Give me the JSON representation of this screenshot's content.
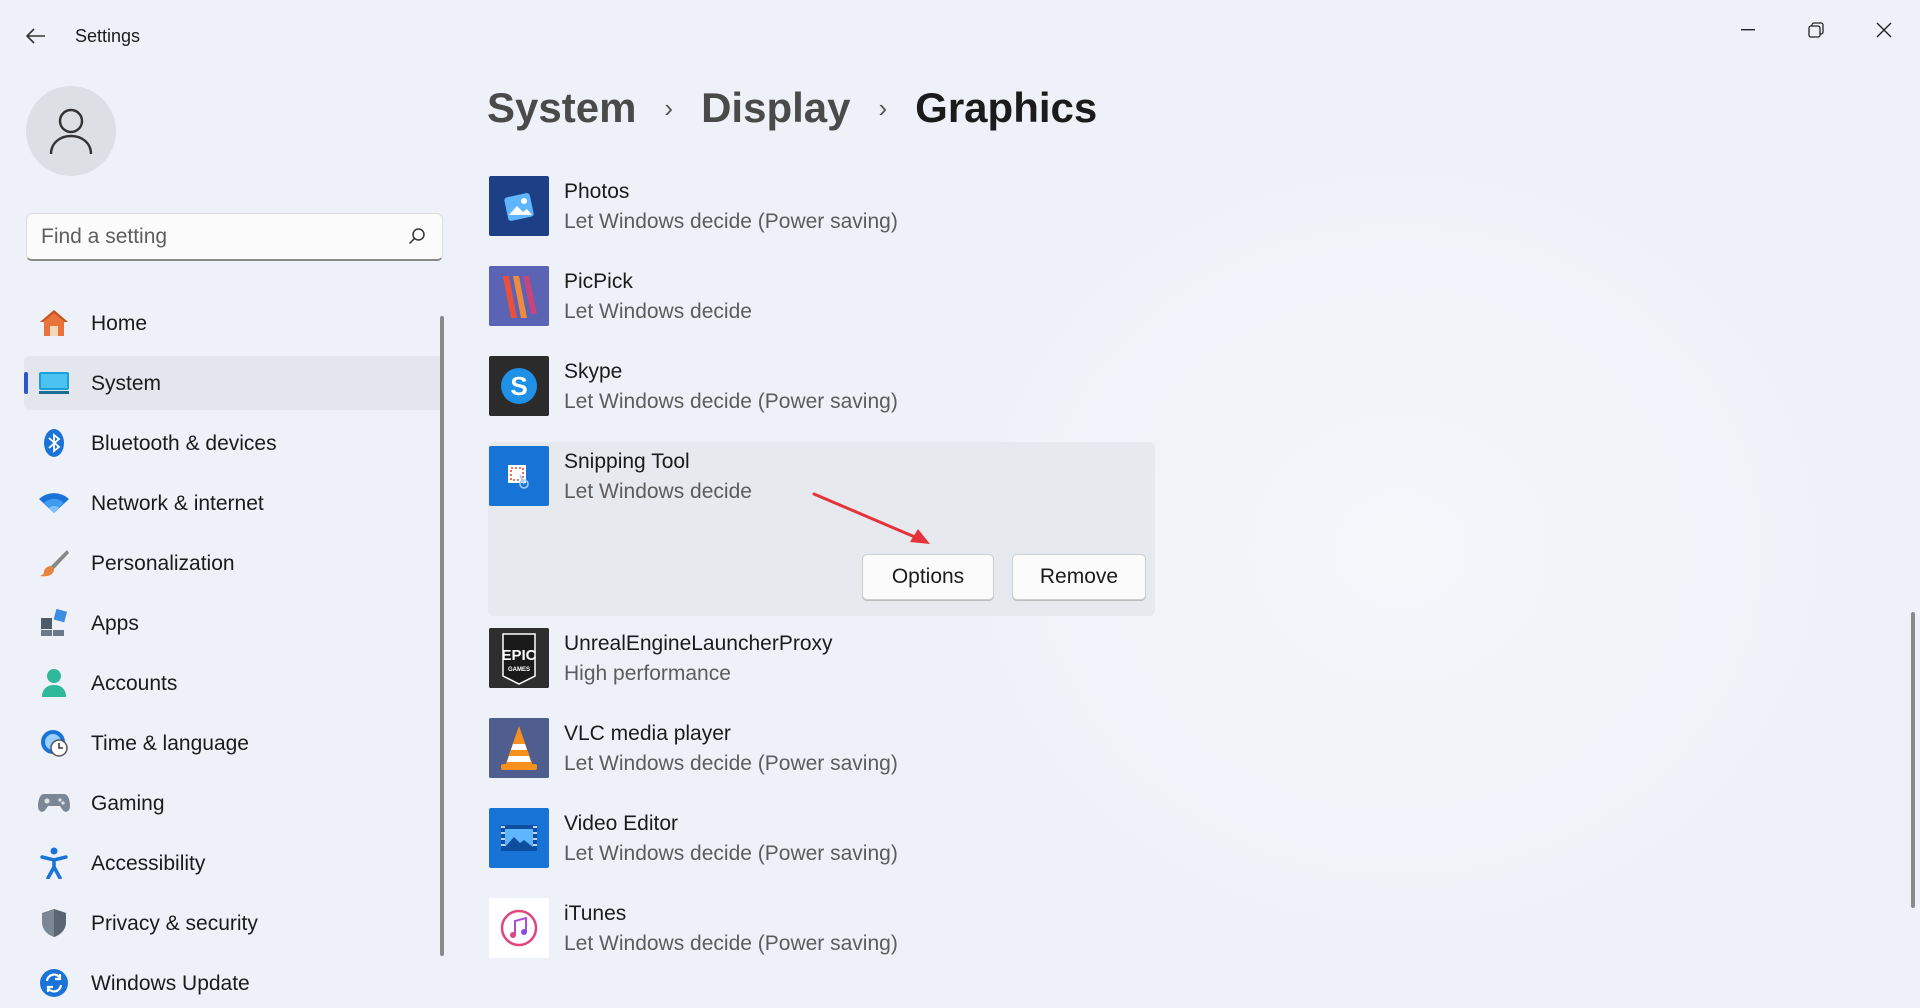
{
  "window": {
    "title": "Settings"
  },
  "sidebar": {
    "search_placeholder": "Find a setting",
    "items": [
      {
        "label": "Home",
        "icon": "home-icon"
      },
      {
        "label": "System",
        "icon": "system-icon",
        "active": true
      },
      {
        "label": "Bluetooth & devices",
        "icon": "bluetooth-icon"
      },
      {
        "label": "Network & internet",
        "icon": "wifi-icon"
      },
      {
        "label": "Personalization",
        "icon": "brush-icon"
      },
      {
        "label": "Apps",
        "icon": "apps-icon"
      },
      {
        "label": "Accounts",
        "icon": "accounts-icon"
      },
      {
        "label": "Time & language",
        "icon": "globe-clock-icon"
      },
      {
        "label": "Gaming",
        "icon": "gamepad-icon"
      },
      {
        "label": "Accessibility",
        "icon": "accessibility-icon"
      },
      {
        "label": "Privacy & security",
        "icon": "shield-icon"
      },
      {
        "label": "Windows Update",
        "icon": "update-icon"
      }
    ]
  },
  "breadcrumb": {
    "items": [
      "System",
      "Display"
    ],
    "current": "Graphics"
  },
  "apps": [
    {
      "name": "Photos",
      "preference": "Let Windows decide (Power saving)"
    },
    {
      "name": "PicPick",
      "preference": "Let Windows decide"
    },
    {
      "name": "Skype",
      "preference": "Let Windows decide (Power saving)"
    },
    {
      "name": "Snipping Tool",
      "preference": "Let Windows decide",
      "expanded": true
    },
    {
      "name": "UnrealEngineLauncherProxy",
      "preference": "High performance"
    },
    {
      "name": "VLC media player",
      "preference": "Let Windows decide (Power saving)"
    },
    {
      "name": "Video Editor",
      "preference": "Let Windows decide (Power saving)"
    },
    {
      "name": "iTunes",
      "preference": "Let Windows decide (Power saving)"
    }
  ],
  "expanded_actions": {
    "options_label": "Options",
    "remove_label": "Remove"
  },
  "epic_logo_text": "EPIC",
  "epic_logo_sub": "GAMES",
  "colors": {
    "accent": "#2f56c7",
    "annotation_arrow": "#e5333b"
  }
}
